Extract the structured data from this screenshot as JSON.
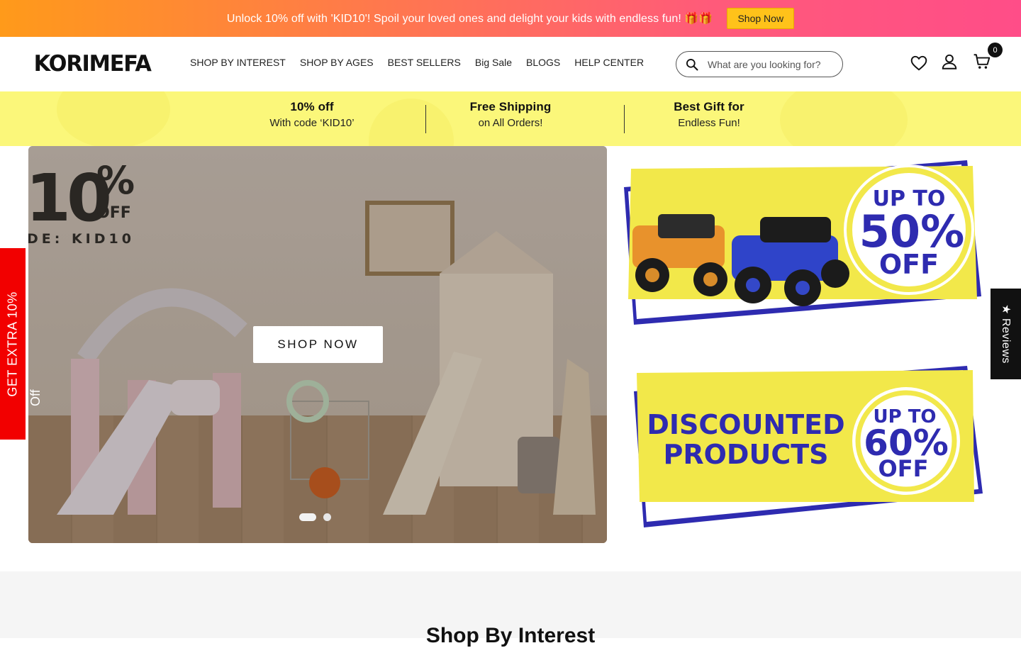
{
  "announcement": {
    "text": "Unlock 10% off with 'KID10'! Spoil your loved ones and delight your kids with endless fun! 🎁🎁",
    "button_label": "Shop Now"
  },
  "header": {
    "logo": "KORIMEFA",
    "nav": [
      "SHOP BY INTEREST",
      "SHOP BY AGES",
      "BEST SELLERS",
      "Big Sale",
      "BLOGS",
      "HELP CENTER"
    ],
    "search_placeholder": "What are you looking for?",
    "cart_count": "0"
  },
  "perks": [
    {
      "title": "10% off",
      "subtitle": "With code ‘KID10’"
    },
    {
      "title": "Free Shipping",
      "subtitle": "on All Orders!"
    },
    {
      "title": "Best Gift for",
      "subtitle": "Endless Fun!"
    }
  ],
  "hero": {
    "big_number": "10",
    "percent": "%",
    "off_label": "OFF",
    "code_label": "DE: KID10",
    "button_label": "SHOP NOW",
    "slides": 2,
    "active_slide": 1
  },
  "side_tab": {
    "label": "GET EXTRA 10%",
    "sub_label": "Off"
  },
  "reviews_tab": {
    "label": "★ Reviews"
  },
  "promos": {
    "top": {
      "line1": "UP TO",
      "line2": "50%",
      "line3": "OFF"
    },
    "bottom": {
      "heading1": "DISCOUNTED",
      "heading2": "PRODUCTS",
      "line1": "UP TO",
      "line2": "60%",
      "line3": "OFF"
    }
  },
  "section": {
    "title": "Shop By Interest"
  },
  "colors": {
    "accent_yellow": "#f4e94a",
    "promo_blue": "#2e2bb0",
    "announce_start": "#ff9a1a",
    "announce_end": "#ff4d88",
    "side_tab_red": "#f20000"
  }
}
